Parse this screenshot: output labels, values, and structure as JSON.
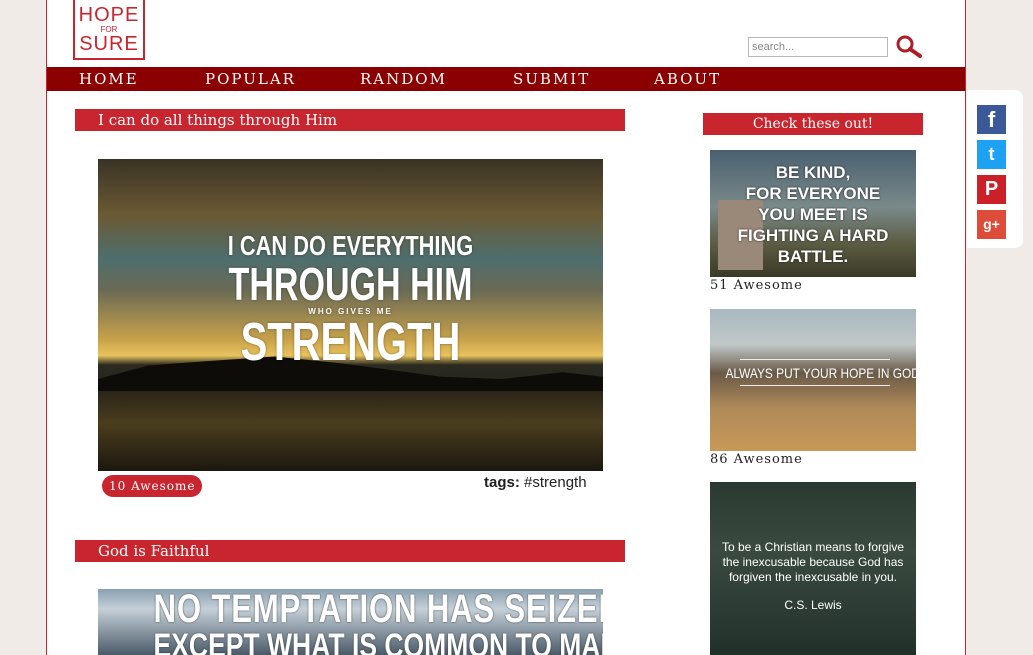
{
  "logo": {
    "line1": "HOPE",
    "line2": "FOR",
    "line3": "SURE"
  },
  "search": {
    "placeholder": "search..."
  },
  "nav": {
    "items": [
      "HOME",
      "POPULAR",
      "RANDOM",
      "SUBMIT",
      "ABOUT"
    ]
  },
  "posts": [
    {
      "title": "I can do all things through Him",
      "image_text": [
        "I CAN DO EVERYTHING",
        "THROUGH HIM",
        "WHO GIVES ME",
        "STRENGTH"
      ],
      "awesome": "10 Awesome",
      "tags_label": "tags:",
      "tags": "#strength"
    },
    {
      "title": "God is Faithful",
      "image_text": [
        "NO TEMPTATION HAS SEIZED YOU",
        "EXCEPT WHAT IS COMMON TO MAN"
      ]
    }
  ],
  "sidebar": {
    "title": "Check these out!",
    "items": [
      {
        "image_text": [
          "BE KIND,",
          "FOR EVERYONE",
          "YOU MEET IS",
          "FIGHTING A HARD",
          "BATTLE."
        ],
        "count": "51 Awesome"
      },
      {
        "image_text": "ALWAYS PUT YOUR HOPE IN GOD",
        "count": "86 Awesome"
      },
      {
        "image_text": "To be a Christian means to forgive the inexcusable because God has forgiven the inexcusable in you.",
        "author": "C.S. Lewis"
      }
    ]
  },
  "social": [
    {
      "name": "facebook",
      "glyph": "f",
      "color": "#3b5998"
    },
    {
      "name": "twitter",
      "glyph": "t",
      "color": "#1da1f2"
    },
    {
      "name": "pinterest",
      "glyph": "P",
      "color": "#cb2027"
    },
    {
      "name": "google-plus",
      "glyph": "g+",
      "color": "#dd4b39"
    }
  ],
  "colors": {
    "accent": "#c9252f",
    "nav": "#8b0000",
    "background": "#f0ebe6"
  }
}
